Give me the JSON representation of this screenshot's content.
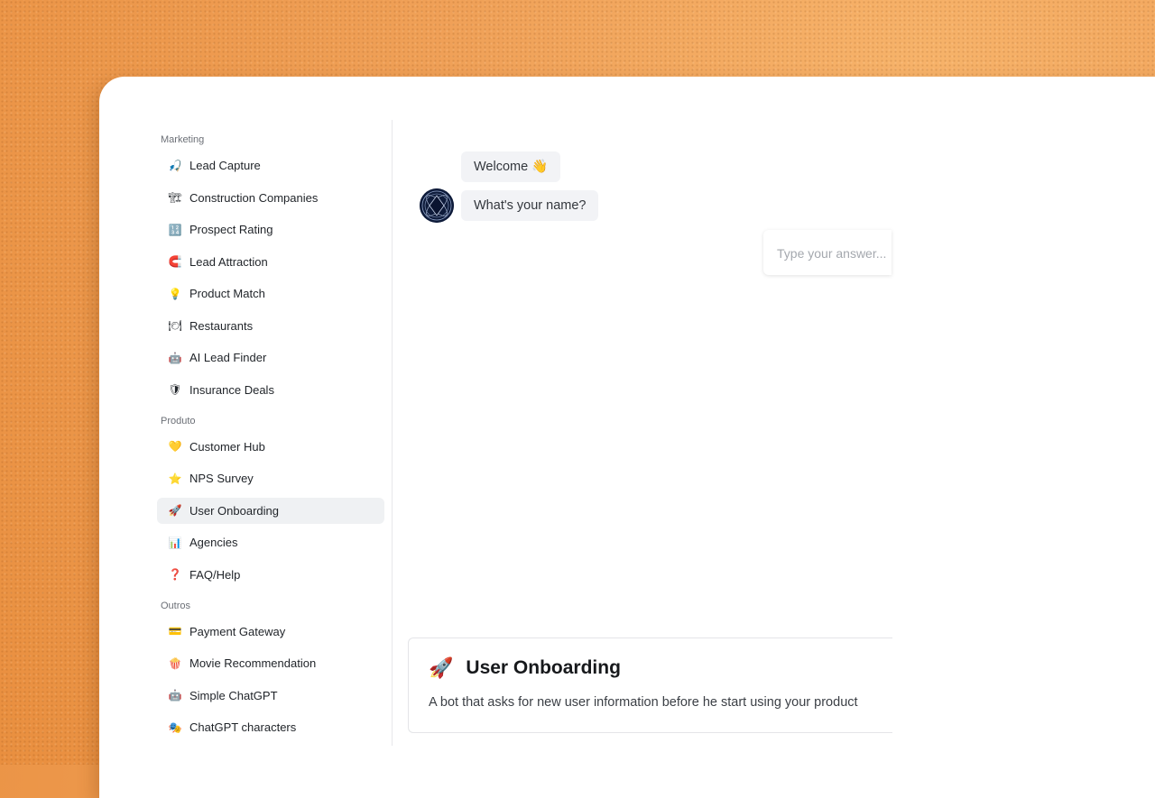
{
  "sidebar": {
    "sections": [
      {
        "title": "Marketing",
        "items": [
          {
            "label": "Lead Capture",
            "icon": "🎣"
          },
          {
            "label": "Construction Companies",
            "icon": "🏗"
          },
          {
            "label": "Prospect Rating",
            "icon": "🔢"
          },
          {
            "label": "Lead Attraction",
            "icon": "🧲"
          },
          {
            "label": "Product Match",
            "icon": "💡"
          },
          {
            "label": "Restaurants",
            "icon": "🍽"
          },
          {
            "label": "AI Lead Finder",
            "icon": "🤖"
          },
          {
            "label": "Insurance Deals",
            "icon": "🛡"
          }
        ]
      },
      {
        "title": "Produto",
        "items": [
          {
            "label": "Customer Hub",
            "icon": "💛"
          },
          {
            "label": "NPS Survey",
            "icon": "⭐"
          },
          {
            "label": "User Onboarding",
            "icon": "🚀",
            "active": true
          },
          {
            "label": "Agencies",
            "icon": "📊"
          },
          {
            "label": "FAQ/Help",
            "icon": "❓"
          }
        ]
      },
      {
        "title": "Outros",
        "items": [
          {
            "label": "Payment Gateway",
            "icon": "💳"
          },
          {
            "label": "Movie Recommendation",
            "icon": "🍿"
          },
          {
            "label": "Simple ChatGPT",
            "icon": "🤖"
          },
          {
            "label": "ChatGPT characters",
            "icon": "🎭"
          }
        ]
      }
    ]
  },
  "chat": {
    "messages": [
      "Welcome 👋",
      "What's your name?"
    ],
    "input_placeholder": "Type your answer..."
  },
  "card": {
    "icon": "🚀",
    "title": "User Onboarding",
    "description": "A bot that asks for new user information before he start using your product"
  },
  "colors": {
    "background": "#f0a158",
    "active_item": "#eff1f3",
    "bubble": "#f2f3f6",
    "avatar": "#0e1b3a"
  }
}
